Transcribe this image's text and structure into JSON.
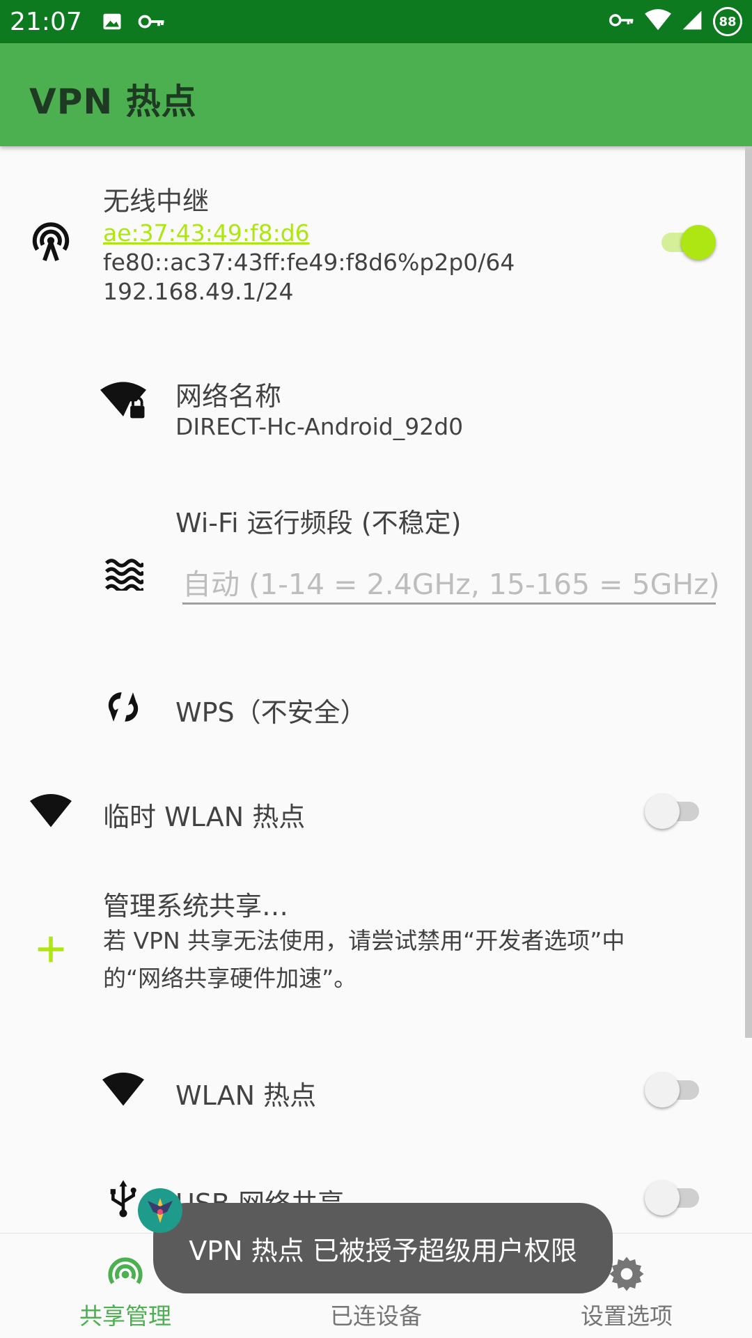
{
  "status_bar": {
    "time": "21:07",
    "battery": "88",
    "icons": [
      "image-icon",
      "key-icon",
      "vpn-key-icon",
      "wifi-icon",
      "signal-icon",
      "battery-icon"
    ]
  },
  "app_bar": {
    "title": "VPN 热点"
  },
  "repeater": {
    "title": "无线中继",
    "mac": "ae:37:43:49:f8:d6",
    "ipv6": "fe80::ac37:43ff:fe49:f8d6%p2p0/64",
    "ipv4": "192.168.49.1/24",
    "enabled": true,
    "icon": "wifi-tethering-icon"
  },
  "network_name": {
    "title": "网络名称",
    "value": "DIRECT-Hc-Android_92d0",
    "icon": "wifi-lock-icon"
  },
  "wifi_band": {
    "title": "Wi-Fi 运行频段 (不稳定)",
    "placeholder": "自动 (1-14 = 2.4GHz, 15-165 = 5GHz)",
    "icon": "waves-icon"
  },
  "wps": {
    "title": "WPS（不安全）",
    "icon": "wps-icon"
  },
  "temp_hotspot": {
    "title": "临时 WLAN 热点",
    "enabled": false,
    "icon": "wifi-icon"
  },
  "manage": {
    "title": "管理系统共享…",
    "desc_line1": "若 VPN 共享无法使用，请尝试禁用“开发者选项”中",
    "desc_line2": "的“网络共享硬件加速”。",
    "icon": "add-icon",
    "accent": "#aee614"
  },
  "wlan_hotspot": {
    "title": "WLAN 热点",
    "enabled": false,
    "icon": "wifi-icon"
  },
  "usb_tether": {
    "title": "USB 网络共享",
    "enabled": false,
    "icon": "usb-icon"
  },
  "bottom_nav": {
    "items": [
      {
        "label": "共享管理",
        "icon": "tethering-icon",
        "active": true
      },
      {
        "label": "已连设备",
        "icon": "devices-icon",
        "active": false
      },
      {
        "label": "设置选项",
        "icon": "settings-icon",
        "active": false
      }
    ]
  },
  "toast": {
    "message": "VPN 热点 已被授予超级用户权限"
  },
  "colors": {
    "status_bar": "#0d7a1f",
    "app_bar": "#4caf50",
    "accent": "#aee614"
  }
}
